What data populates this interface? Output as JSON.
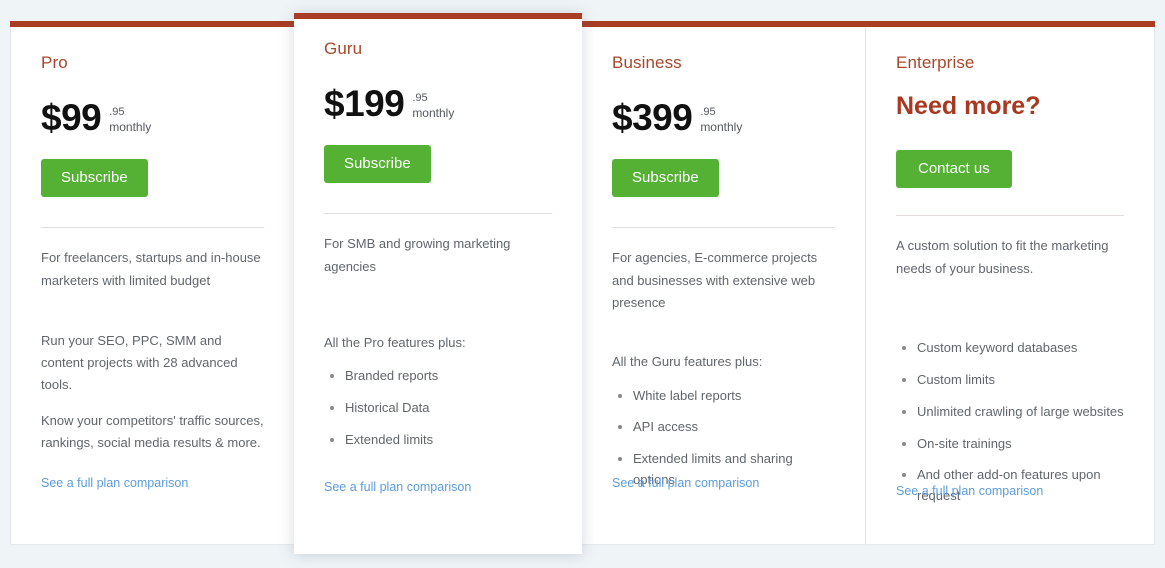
{
  "theme": {
    "page_background": "#eff4f7",
    "accent_bar_color": "#a93c22",
    "plan_name_color": "#a8472c",
    "cta_color": "#54b134",
    "link_color": "#5c9cdf",
    "heading_color": "#a8381f"
  },
  "plans": [
    {
      "id": "pro",
      "name": "Pro",
      "price_major": "$99",
      "price_cents": ".95",
      "price_period": "monthly",
      "cta_label": "Subscribe",
      "description": "For freelancers, startups and in-house marketers with limited budget",
      "body_paragraph_1": "Run your SEO, PPC, SMM and content projects with 28 advanced tools.",
      "body_paragraph_2": "Know your competitors' traffic sources, rankings, social media results & more.",
      "compare_link": "See a full plan comparison"
    },
    {
      "id": "guru",
      "name": "Guru",
      "price_major": "$199",
      "price_cents": ".95",
      "price_period": "monthly",
      "cta_label": "Subscribe",
      "description": "For SMB and growing marketing agencies",
      "features_intro": "All the Pro features plus:",
      "features": [
        "Branded reports",
        "Historical Data",
        "Extended limits"
      ],
      "compare_link": "See a full plan comparison"
    },
    {
      "id": "business",
      "name": "Business",
      "price_major": "$399",
      "price_cents": ".95",
      "price_period": "monthly",
      "cta_label": "Subscribe",
      "description": "For agencies, E-commerce projects and businesses with extensive web presence",
      "features_intro": "All the Guru features plus:",
      "features": [
        "White label reports",
        "API access",
        "Extended limits and sharing options"
      ],
      "compare_link": "See a full plan comparison"
    },
    {
      "id": "enterprise",
      "name": "Enterprise",
      "headline": "Need more?",
      "cta_label": "Contact us",
      "description": "A custom solution to fit the marketing needs of your business.",
      "features": [
        "Custom keyword databases",
        "Custom limits",
        "Unlimited crawling of large websites",
        "On-site trainings",
        "And other add-on features upon request"
      ],
      "compare_link": "See a full plan comparison"
    }
  ]
}
